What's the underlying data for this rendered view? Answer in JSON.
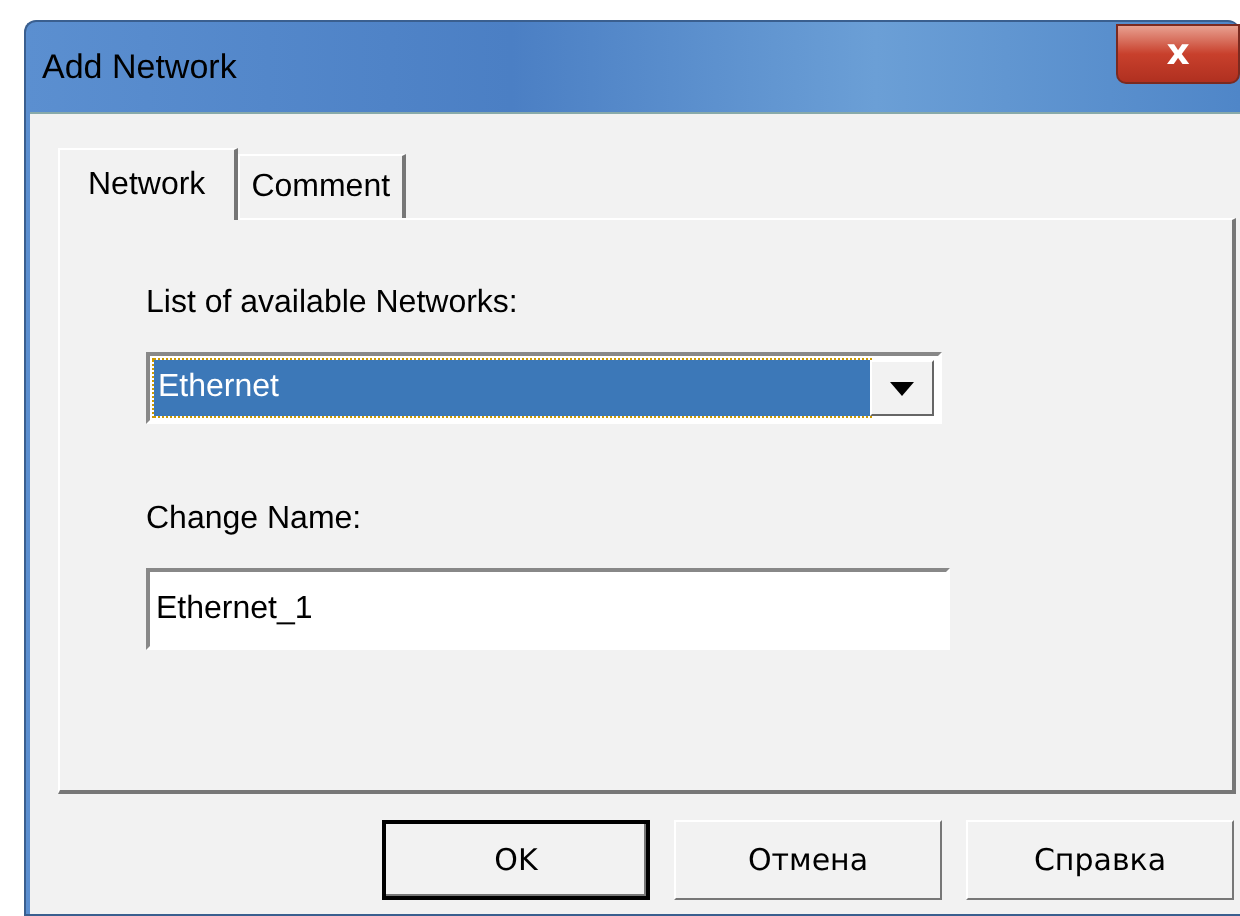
{
  "window": {
    "title": "Add Network",
    "close": "x"
  },
  "tabs": [
    {
      "label": "Network",
      "selected": true
    },
    {
      "label": "Comment",
      "selected": false
    }
  ],
  "network_select": {
    "label": "List of available Networks:",
    "value": "Ethernet",
    "focused": true
  },
  "name_field": {
    "label": "Change Name:",
    "value": "Ethernet_1"
  },
  "buttons": [
    {
      "label": "OK",
      "default": true
    },
    {
      "label": "Отмена",
      "default": false
    },
    {
      "label": "Справка",
      "default": false
    }
  ]
}
